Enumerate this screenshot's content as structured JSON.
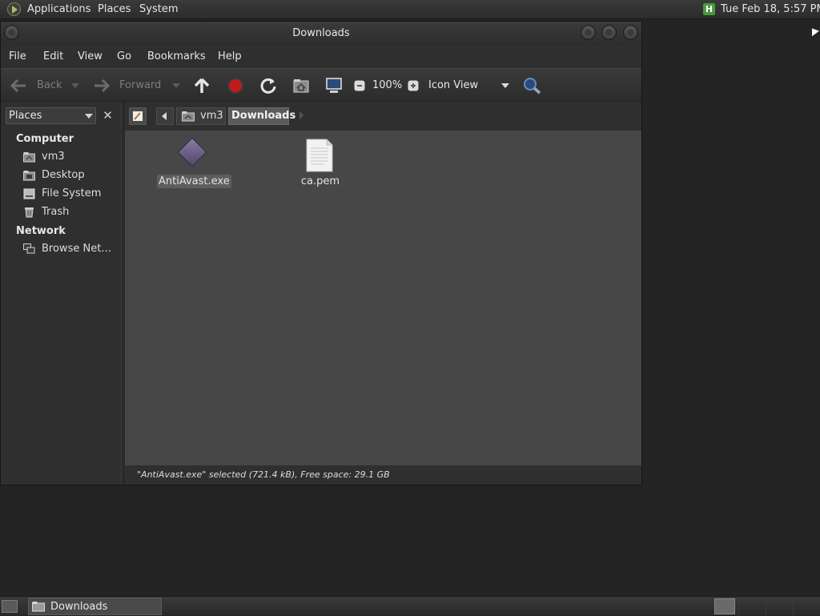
{
  "top_panel": {
    "menus": [
      "Applications",
      "Places",
      "System"
    ],
    "clock": "Tue Feb 18,  5:57 PM",
    "tray_icon": "H",
    "icons": {
      "apps": "apps-logo-icon",
      "tray": "update-notifier-icon"
    }
  },
  "window": {
    "title": "Downloads",
    "menu": [
      "File",
      "Edit",
      "View",
      "Go",
      "Bookmarks",
      "Help"
    ],
    "toolbar": {
      "back": "Back",
      "forward": "Forward",
      "zoom": "100%",
      "view_mode": "Icon View"
    },
    "sidebar": {
      "selector": "Places",
      "sections": [
        {
          "heading": "Computer",
          "items": [
            {
              "label": "vm3",
              "icon": "home-folder-icon"
            },
            {
              "label": "Desktop",
              "icon": "desktop-folder-icon"
            },
            {
              "label": "File System",
              "icon": "harddisk-icon"
            },
            {
              "label": "Trash",
              "icon": "trash-icon"
            }
          ]
        },
        {
          "heading": "Network",
          "items": [
            {
              "label": "Browse Net…",
              "icon": "network-icon"
            }
          ]
        }
      ]
    },
    "breadcrumbs": [
      "vm3",
      "Downloads"
    ],
    "files": [
      {
        "name": "AntiAvast.exe",
        "icon": "executable-icon",
        "selected": true
      },
      {
        "name": "ca.pem",
        "icon": "text-file-icon",
        "selected": false
      }
    ],
    "status": "\"AntiAvast.exe\" selected (721.4 kB), Free space: 29.1 GB"
  },
  "bottom_panel": {
    "tasks": [
      "Downloads"
    ]
  },
  "colors": {
    "desktop_bg": "#242424",
    "content_bg": "#474747",
    "panel_bg": "#2f2f2f",
    "stop_red": "#c01c1c"
  }
}
